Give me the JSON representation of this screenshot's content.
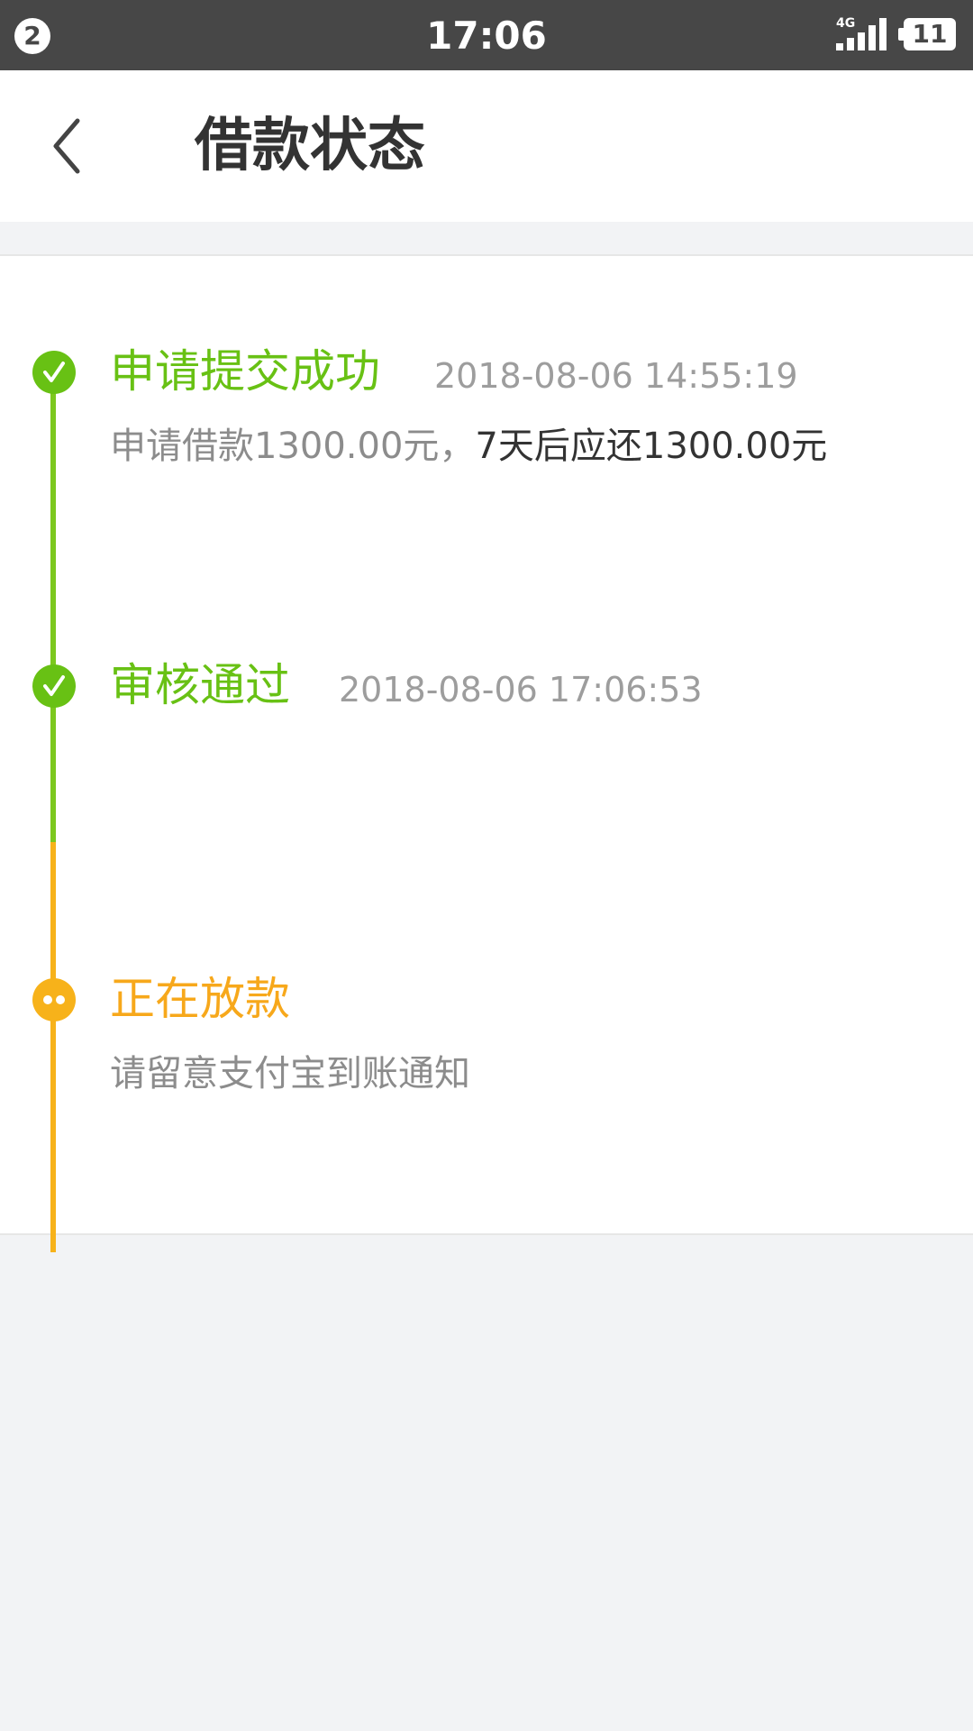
{
  "status_bar": {
    "notification_count": "2",
    "time": "17:06",
    "network": "4G",
    "battery": "11"
  },
  "header": {
    "title": "借款状态"
  },
  "steps": [
    {
      "title": "申请提交成功",
      "time": "2018-08-06 14:55:19",
      "desc_part1": "申请借款1300.00元，",
      "desc_part2": "7天后应还1300.00元",
      "state": "done"
    },
    {
      "title": "审核通过",
      "time": "2018-08-06 17:06:53",
      "state": "done"
    },
    {
      "title": "正在放款",
      "desc": "请留意支付宝到账通知",
      "state": "pending"
    }
  ],
  "colors": {
    "done": "#68c114",
    "pending": "#f7b21a",
    "status_bar": "#474747"
  },
  "icons": {
    "back": "chevron-left-icon",
    "done": "check-circle-icon",
    "pending": "dots-circle-icon"
  }
}
